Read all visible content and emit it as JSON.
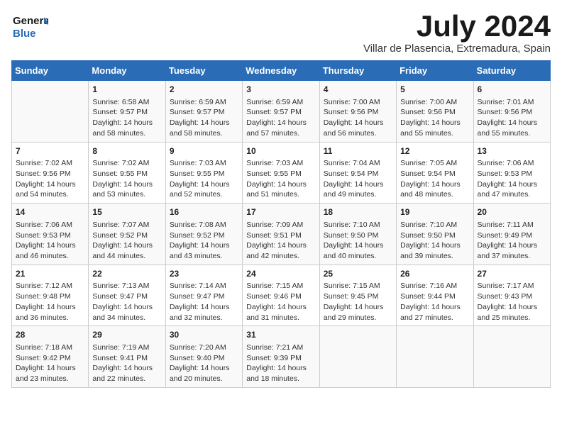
{
  "header": {
    "logo_line1": "General",
    "logo_line2": "Blue",
    "month_title": "July 2024",
    "subtitle": "Villar de Plasencia, Extremadura, Spain"
  },
  "days_of_week": [
    "Sunday",
    "Monday",
    "Tuesday",
    "Wednesday",
    "Thursday",
    "Friday",
    "Saturday"
  ],
  "weeks": [
    [
      {
        "day": "",
        "content": ""
      },
      {
        "day": "1",
        "content": "Sunrise: 6:58 AM\nSunset: 9:57 PM\nDaylight: 14 hours\nand 58 minutes."
      },
      {
        "day": "2",
        "content": "Sunrise: 6:59 AM\nSunset: 9:57 PM\nDaylight: 14 hours\nand 58 minutes."
      },
      {
        "day": "3",
        "content": "Sunrise: 6:59 AM\nSunset: 9:57 PM\nDaylight: 14 hours\nand 57 minutes."
      },
      {
        "day": "4",
        "content": "Sunrise: 7:00 AM\nSunset: 9:56 PM\nDaylight: 14 hours\nand 56 minutes."
      },
      {
        "day": "5",
        "content": "Sunrise: 7:00 AM\nSunset: 9:56 PM\nDaylight: 14 hours\nand 55 minutes."
      },
      {
        "day": "6",
        "content": "Sunrise: 7:01 AM\nSunset: 9:56 PM\nDaylight: 14 hours\nand 55 minutes."
      }
    ],
    [
      {
        "day": "7",
        "content": "Sunrise: 7:02 AM\nSunset: 9:56 PM\nDaylight: 14 hours\nand 54 minutes."
      },
      {
        "day": "8",
        "content": "Sunrise: 7:02 AM\nSunset: 9:55 PM\nDaylight: 14 hours\nand 53 minutes."
      },
      {
        "day": "9",
        "content": "Sunrise: 7:03 AM\nSunset: 9:55 PM\nDaylight: 14 hours\nand 52 minutes."
      },
      {
        "day": "10",
        "content": "Sunrise: 7:03 AM\nSunset: 9:55 PM\nDaylight: 14 hours\nand 51 minutes."
      },
      {
        "day": "11",
        "content": "Sunrise: 7:04 AM\nSunset: 9:54 PM\nDaylight: 14 hours\nand 49 minutes."
      },
      {
        "day": "12",
        "content": "Sunrise: 7:05 AM\nSunset: 9:54 PM\nDaylight: 14 hours\nand 48 minutes."
      },
      {
        "day": "13",
        "content": "Sunrise: 7:06 AM\nSunset: 9:53 PM\nDaylight: 14 hours\nand 47 minutes."
      }
    ],
    [
      {
        "day": "14",
        "content": "Sunrise: 7:06 AM\nSunset: 9:53 PM\nDaylight: 14 hours\nand 46 minutes."
      },
      {
        "day": "15",
        "content": "Sunrise: 7:07 AM\nSunset: 9:52 PM\nDaylight: 14 hours\nand 44 minutes."
      },
      {
        "day": "16",
        "content": "Sunrise: 7:08 AM\nSunset: 9:52 PM\nDaylight: 14 hours\nand 43 minutes."
      },
      {
        "day": "17",
        "content": "Sunrise: 7:09 AM\nSunset: 9:51 PM\nDaylight: 14 hours\nand 42 minutes."
      },
      {
        "day": "18",
        "content": "Sunrise: 7:10 AM\nSunset: 9:50 PM\nDaylight: 14 hours\nand 40 minutes."
      },
      {
        "day": "19",
        "content": "Sunrise: 7:10 AM\nSunset: 9:50 PM\nDaylight: 14 hours\nand 39 minutes."
      },
      {
        "day": "20",
        "content": "Sunrise: 7:11 AM\nSunset: 9:49 PM\nDaylight: 14 hours\nand 37 minutes."
      }
    ],
    [
      {
        "day": "21",
        "content": "Sunrise: 7:12 AM\nSunset: 9:48 PM\nDaylight: 14 hours\nand 36 minutes."
      },
      {
        "day": "22",
        "content": "Sunrise: 7:13 AM\nSunset: 9:47 PM\nDaylight: 14 hours\nand 34 minutes."
      },
      {
        "day": "23",
        "content": "Sunrise: 7:14 AM\nSunset: 9:47 PM\nDaylight: 14 hours\nand 32 minutes."
      },
      {
        "day": "24",
        "content": "Sunrise: 7:15 AM\nSunset: 9:46 PM\nDaylight: 14 hours\nand 31 minutes."
      },
      {
        "day": "25",
        "content": "Sunrise: 7:15 AM\nSunset: 9:45 PM\nDaylight: 14 hours\nand 29 minutes."
      },
      {
        "day": "26",
        "content": "Sunrise: 7:16 AM\nSunset: 9:44 PM\nDaylight: 14 hours\nand 27 minutes."
      },
      {
        "day": "27",
        "content": "Sunrise: 7:17 AM\nSunset: 9:43 PM\nDaylight: 14 hours\nand 25 minutes."
      }
    ],
    [
      {
        "day": "28",
        "content": "Sunrise: 7:18 AM\nSunset: 9:42 PM\nDaylight: 14 hours\nand 23 minutes."
      },
      {
        "day": "29",
        "content": "Sunrise: 7:19 AM\nSunset: 9:41 PM\nDaylight: 14 hours\nand 22 minutes."
      },
      {
        "day": "30",
        "content": "Sunrise: 7:20 AM\nSunset: 9:40 PM\nDaylight: 14 hours\nand 20 minutes."
      },
      {
        "day": "31",
        "content": "Sunrise: 7:21 AM\nSunset: 9:39 PM\nDaylight: 14 hours\nand 18 minutes."
      },
      {
        "day": "",
        "content": ""
      },
      {
        "day": "",
        "content": ""
      },
      {
        "day": "",
        "content": ""
      }
    ]
  ]
}
